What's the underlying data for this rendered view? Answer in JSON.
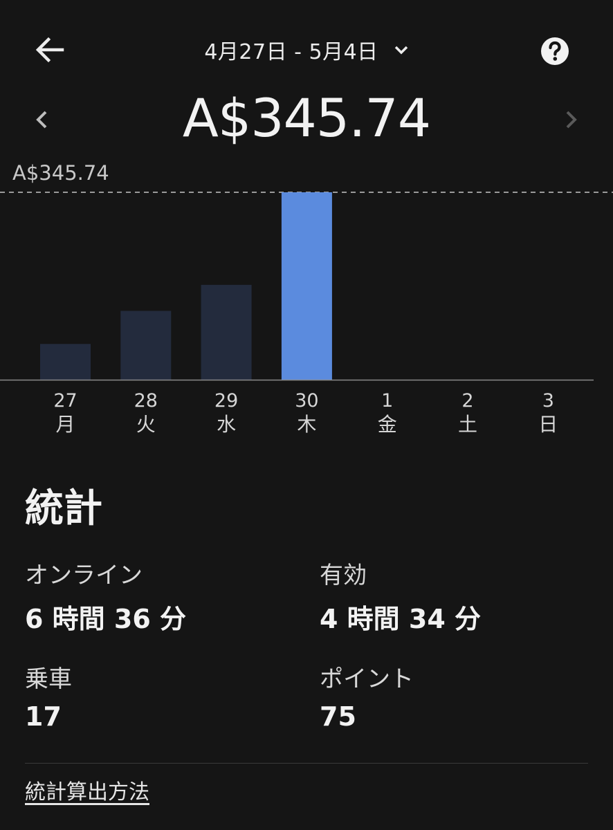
{
  "header": {
    "date_range": "4月27日 - 5月4日",
    "back_icon": "arrow-left-icon",
    "dropdown_icon": "chevron-down-icon",
    "help_icon": "question-circle-icon",
    "prev_icon": "chevron-left-icon",
    "next_icon": "chevron-right-icon"
  },
  "summary": {
    "total": "A$345.74"
  },
  "chart_data": {
    "type": "bar",
    "max_label": "A$345.74",
    "categories": [
      {
        "date": "27",
        "weekday": "月"
      },
      {
        "date": "28",
        "weekday": "火"
      },
      {
        "date": "29",
        "weekday": "水"
      },
      {
        "date": "30",
        "weekday": "木"
      },
      {
        "date": "1",
        "weekday": "金"
      },
      {
        "date": "2",
        "weekday": "土"
      },
      {
        "date": "3",
        "weekday": "日"
      }
    ],
    "values": [
      66,
      127,
      175,
      345.74,
      0,
      0,
      0
    ],
    "ylim": [
      0,
      345.74
    ],
    "selected_index": 3,
    "colors": {
      "default_bar": "#232b3d",
      "selected_bar": "#5b8bde",
      "baseline": "#8a8a8a",
      "max_line": "#9a9a9a"
    }
  },
  "stats": {
    "title": "統計",
    "items": [
      {
        "label": "オンライン",
        "value": "6 時間 36 分"
      },
      {
        "label": "有効",
        "value": "4 時間 34 分"
      },
      {
        "label": "乗車",
        "value": "17"
      },
      {
        "label": "ポイント",
        "value": "75"
      }
    ],
    "method_link": "統計算出方法"
  }
}
